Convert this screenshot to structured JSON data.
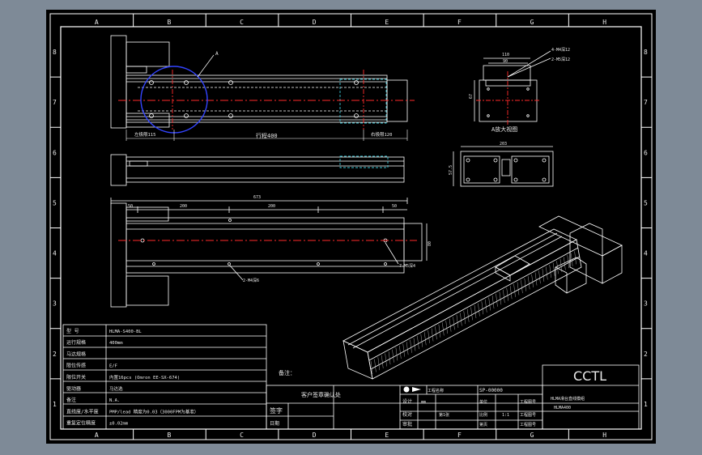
{
  "colors": {
    "viewport_bg": "#7e8a97",
    "paper": "#000000",
    "line": "#ffffff",
    "centerline": "#ff2a2a",
    "detail_circle": "#3344ff",
    "hidden": "#39c3d3"
  },
  "grid": {
    "columns": [
      "A",
      "B",
      "C",
      "D",
      "E",
      "F",
      "G",
      "H"
    ],
    "rows": [
      "8",
      "7",
      "6",
      "5",
      "4",
      "3",
      "2",
      "1"
    ]
  },
  "views": {
    "detail_label": "A",
    "left_travel": "左极限115",
    "stroke": "行程400",
    "right_travel": "右极限120",
    "mount_dim_top": "110",
    "mount_dim_inner": "90",
    "mount_hole_note_1": "4-M4深12",
    "mount_hole_note_2": "2-M5深12",
    "mount_height": "67",
    "mount_view_label": "A放大视图",
    "end_width": "203",
    "end_height": "57.5",
    "total_length": "673",
    "dim_a": "50",
    "dim_b": "200",
    "dim_c": "200",
    "dim_d": "50",
    "side_height": "80",
    "hole_note_bottom": "2-M4深6",
    "hole_note_right": "7-M5深4"
  },
  "title_block": {
    "logo": "CCTL",
    "rows": [
      {
        "label": "型 号",
        "value": "HLMA-S400-BL"
      },
      {
        "label": "运行规格",
        "value": "400mm"
      },
      {
        "label": "马达规格",
        "value": ""
      },
      {
        "label": "限位传感",
        "value": "E/F"
      },
      {
        "label": "限位开关",
        "value": "内置16pcs (Omron EE-SX-674)"
      },
      {
        "label": "驱动器",
        "value": "马达选"
      },
      {
        "label": "备注",
        "value": "N.A."
      },
      {
        "label": "直线度/水平度",
        "value": "PMP/lead 精度为0.03（3000FPM为基准）"
      },
      {
        "label": "重复定位精度",
        "value": "±0.02mm"
      }
    ],
    "remark": "备注：",
    "customer_confirm": "客户签章确认处",
    "sign": "签字",
    "date": "日期",
    "project_label": "工程名称",
    "project_value": "SP-00000",
    "design": "设计",
    "check": "校对",
    "approve": "审批",
    "scale_label": "比例",
    "scale_value": "1:1",
    "unit_label": "单位",
    "unit_value": "mm",
    "sheet_label": "第1张",
    "page_label": "第页",
    "drawing_label": "工程图号",
    "drawing_value": "HLMA-S400-BL",
    "product_name": "HLMA滑台直线模组",
    "part_code": "HLMA400"
  }
}
